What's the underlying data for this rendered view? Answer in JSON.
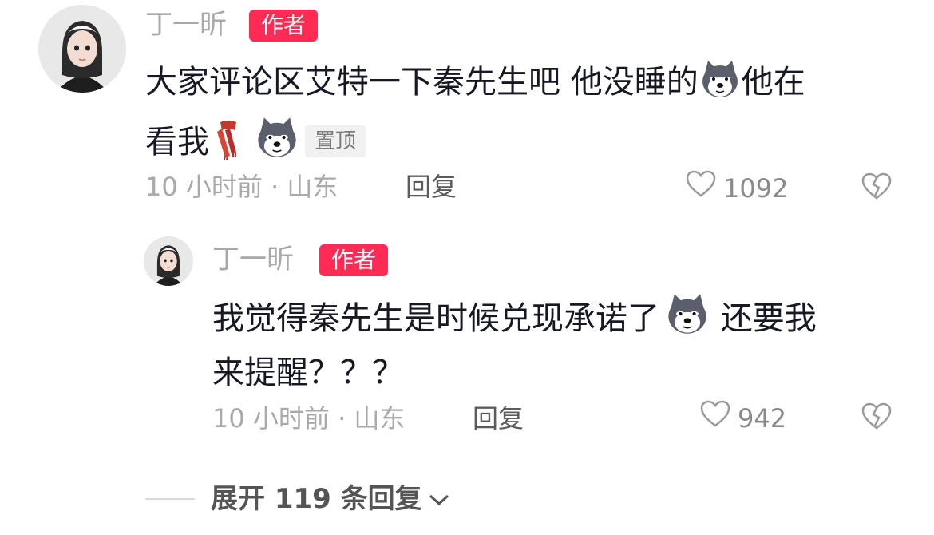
{
  "comments": [
    {
      "author": "丁一昕",
      "badge": "作者",
      "text_line1": "大家评论区艾特一下秦先生吧 他没睡的",
      "text_line1_end": "他在",
      "text_line2": "看我",
      "pinned_label": "置顶",
      "time": "10 小时前",
      "location": "山东",
      "separator": " · ",
      "reply_label": "回复",
      "like_count": "1092"
    },
    {
      "author": "丁一昕",
      "badge": "作者",
      "text_line1": "我觉得秦先生是时候兑现承诺了",
      "text_line1_end": " 还要我",
      "text_line2": "来提醒？？？",
      "time": "10 小时前",
      "location": "山东",
      "separator": " · ",
      "reply_label": "回复",
      "like_count": "942"
    }
  ],
  "expand_replies_label": "展开 119 条回复",
  "icons": {
    "like": "heart-outline-icon",
    "dislike": "broken-heart-icon",
    "expand": "chevron-down-icon",
    "emoji": "dog-emoji-icon",
    "scarf": "scarf-emoji-icon"
  },
  "colors": {
    "badge": "#fe2c55",
    "muted": "#a9a9a9",
    "text": "#161823"
  }
}
